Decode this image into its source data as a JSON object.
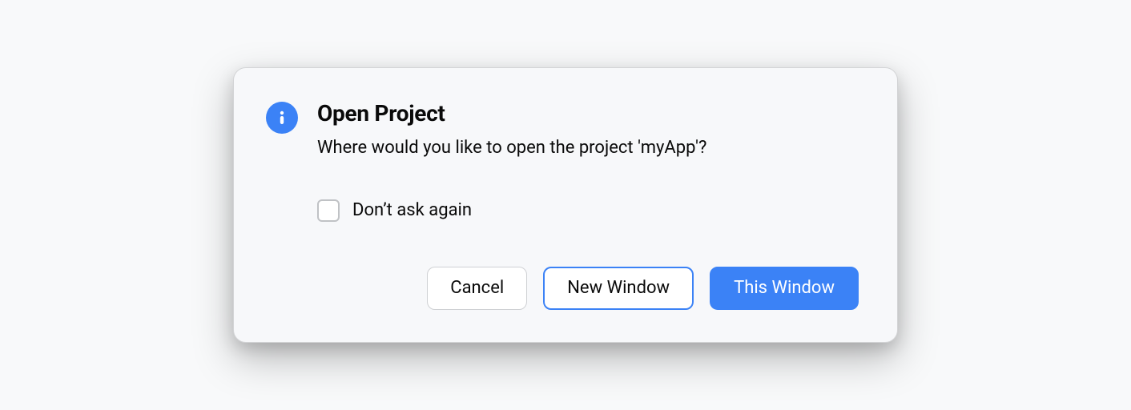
{
  "dialog": {
    "title": "Open Project",
    "message": "Where would you like to open the project 'myApp'?",
    "checkbox_label": "Don’t ask again",
    "buttons": {
      "cancel": "Cancel",
      "new_window": "New Window",
      "this_window": "This Window"
    },
    "icon": "info-icon",
    "accent_color": "#3b82f6"
  }
}
